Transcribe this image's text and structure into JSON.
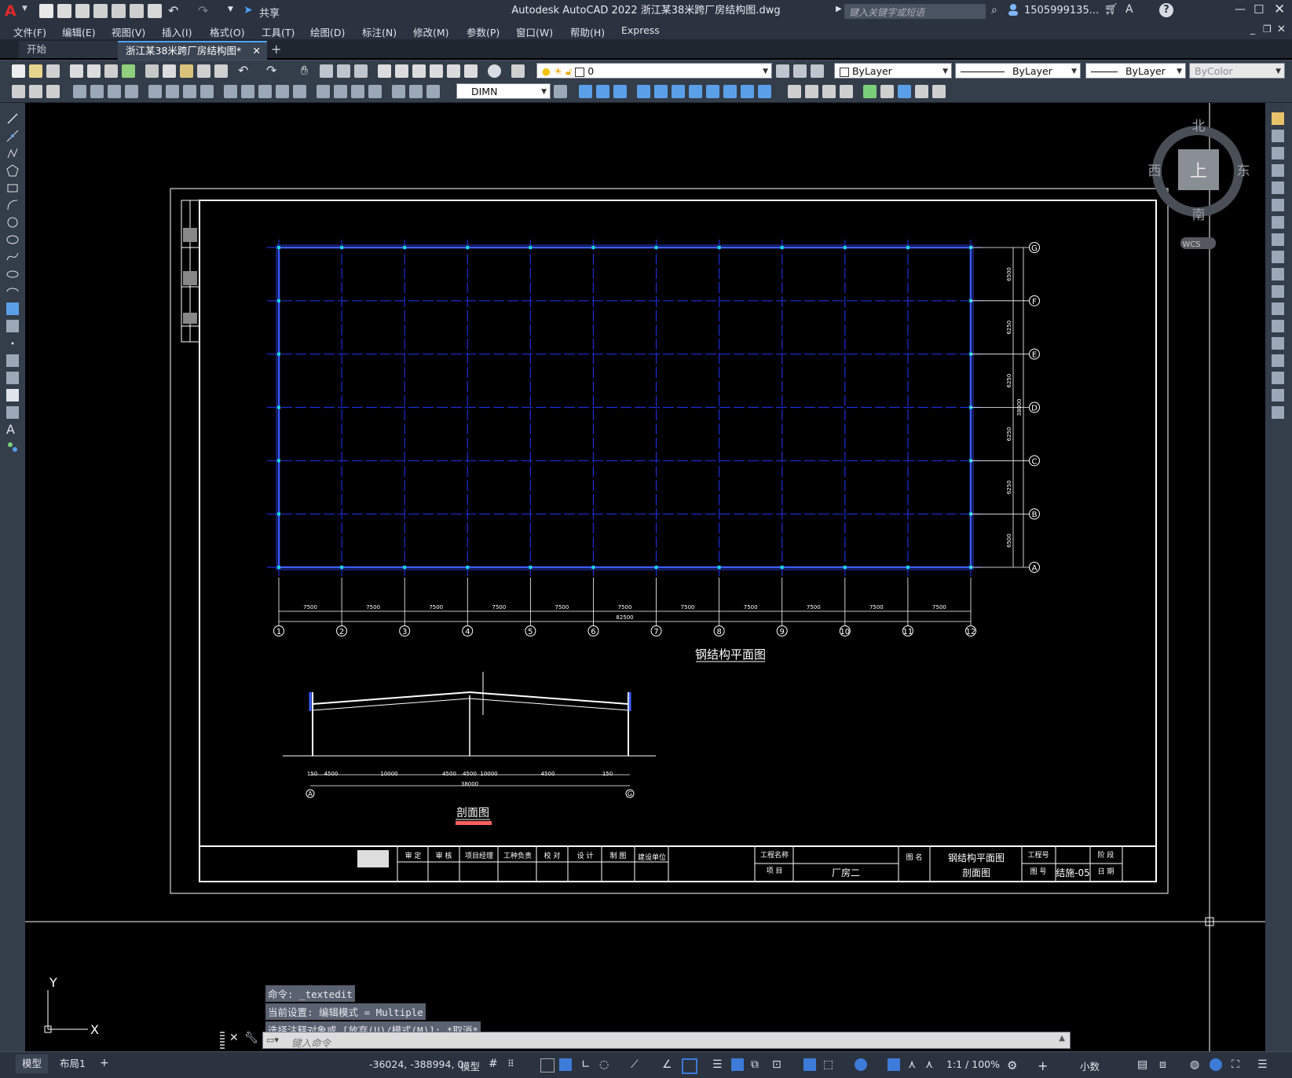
{
  "app": {
    "title": "Autodesk AutoCAD 2022    浙江某38米跨厂房结构图.dwg",
    "logo": "A",
    "share_label": "共享",
    "search_placeholder": "键入关键字或短语",
    "user_name": "1505999135...",
    "help_icon": "?"
  },
  "menu": [
    "文件(F)",
    "编辑(E)",
    "视图(V)",
    "插入(I)",
    "格式(O)",
    "工具(T)",
    "绘图(D)",
    "标注(N)",
    "修改(M)",
    "参数(P)",
    "窗口(W)",
    "帮助(H)",
    "Express"
  ],
  "tabs": {
    "start": "开始",
    "active": "浙江某38米跨厂房结构图*",
    "add": "+"
  },
  "toolbar": {
    "layer_value": "0",
    "color_value": "ByLayer",
    "linetype_value": "ByLayer",
    "lineweight_value": "ByLayer",
    "plotstyle_value": "ByColor",
    "dimstyle_value": "DIMN"
  },
  "viewcube": {
    "north": "北",
    "south": "南",
    "east": "东",
    "west": "西",
    "top": "上",
    "wcs": "WCS"
  },
  "drawing": {
    "plan_title": "钢结构平面图",
    "section_title": "剖面图",
    "col_labels": [
      "1",
      "2",
      "3",
      "4",
      "5",
      "6",
      "7",
      "8",
      "9",
      "10",
      "11",
      "12"
    ],
    "row_labels": [
      "G",
      "F",
      "E",
      "D",
      "C",
      "B",
      "A"
    ],
    "bay_dims": [
      "7500",
      "7500",
      "7500",
      "7500",
      "7500",
      "7500",
      "7500",
      "7500",
      "7500",
      "7500",
      "7500"
    ],
    "total_width": "82500",
    "row_dims": [
      "6500",
      "6250",
      "6250",
      "6250",
      "6250",
      "6500"
    ],
    "total_depth": "38000",
    "section_dims": [
      "150",
      "4500",
      "10000",
      "4500",
      "4500",
      "10000",
      "4500",
      "150"
    ],
    "section_total": "38000",
    "section_axes": [
      "A",
      "G"
    ],
    "title_block": {
      "approved": "审 定",
      "verify": "审 核",
      "manager": "项目经理",
      "chief": "工种负责",
      "checked": "校 对",
      "design": "设 计",
      "drawing": "制 图",
      "construction": "建设单位",
      "project_name": "工程名称",
      "item": "项 目",
      "item_value": "厂房二",
      "drawing_title_label": "图 名",
      "drawing_title_1": "钢结构平面图",
      "drawing_title_2": "剖面图",
      "project_no": "工程号",
      "drawing_no_label": "图 号",
      "drawing_no": "结施-05",
      "stage": "阶 段",
      "date": "日 期"
    }
  },
  "ucs": {
    "y": "Y",
    "x": "X"
  },
  "command": {
    "history": [
      "命令: _textedit",
      "当前设置: 编辑模式 = Multiple",
      "选择注释对象或 [放弃(U)/模式(M)]: *取消*"
    ],
    "placeholder": "键入命令"
  },
  "status": {
    "model_tab": "模型",
    "layout_tab": "布局1",
    "add_tab": "+",
    "coords": "-36024, -388994, 0",
    "space": "模型",
    "scale": "1:1 / 100%",
    "units": "小数"
  }
}
